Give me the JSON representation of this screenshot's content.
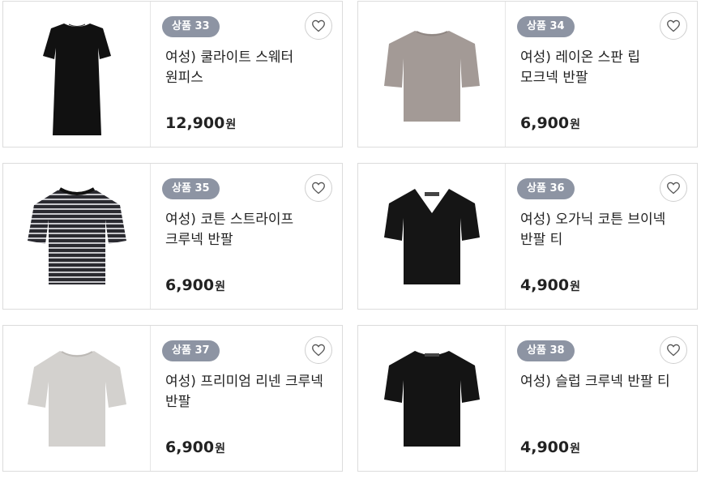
{
  "products": [
    {
      "badge": "상품 33",
      "title": "여성) 쿨라이트 스웨터 원피스",
      "price": "12,900",
      "unit": "원",
      "image_icon": "black-dress-icon",
      "color": "#111111"
    },
    {
      "badge": "상품 34",
      "title": "여성) 레이온 스판 립 모크넥 반팔",
      "price": "6,900",
      "unit": "원",
      "image_icon": "taupe-tshirt-icon",
      "color": "#a39a96"
    },
    {
      "badge": "상품 35",
      "title": "여성) 코튼 스트라이프 크루넥 반팔",
      "price": "6,900",
      "unit": "원",
      "image_icon": "striped-tshirt-icon",
      "color": "#3a3a40"
    },
    {
      "badge": "상품 36",
      "title": "여성) 오가닉 코튼 브이넥 반팔 티",
      "price": "4,900",
      "unit": "원",
      "image_icon": "black-vneck-icon",
      "color": "#151515"
    },
    {
      "badge": "상품 37",
      "title": "여성) 프리미엄 리넨 크루넥 반팔",
      "price": "6,900",
      "unit": "원",
      "image_icon": "light-gray-tshirt-icon",
      "color": "#d3d1ce"
    },
    {
      "badge": "상품 38",
      "title": "여성) 슬럽 크루넥 반팔 티",
      "price": "4,900",
      "unit": "원",
      "image_icon": "black-crewneck-icon",
      "color": "#141414"
    }
  ],
  "colors": {
    "badge_bg": "#8d94a3",
    "border": "#dcdcdc"
  }
}
